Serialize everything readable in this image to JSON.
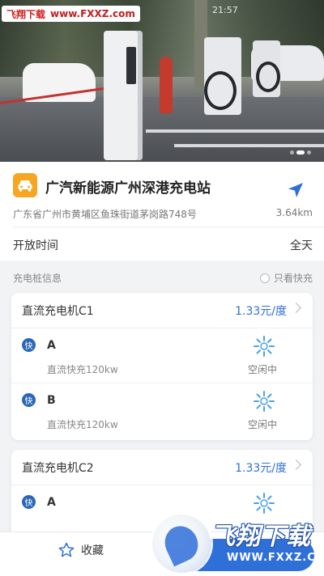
{
  "watermark": {
    "top_cn": "飞翔下载",
    "top_url": "www.FXXZ.com",
    "logo_cn": "飞翔下载",
    "logo_url": "WWW.FXXZ.COM"
  },
  "status_bar": {
    "time": "21:57"
  },
  "hero": {
    "slides_total": 3,
    "active_slide": 2
  },
  "station": {
    "icon": "car-icon",
    "name": "广汽新能源广州深港充电站",
    "address": "广东省广州市黄埔区鱼珠街道茅岗路748号",
    "distance": "3.64km",
    "hours_label": "开放时间",
    "hours_value": "全天"
  },
  "piles_section": {
    "title": "充电桩信息",
    "fast_only_label": "只看快充"
  },
  "piles": [
    {
      "name": "直流充电机C1",
      "price": "1.33元/度",
      "guns": [
        {
          "badge": "快",
          "name": "A",
          "desc": "直流快充120kw",
          "status": "空闲中"
        },
        {
          "badge": "快",
          "name": "B",
          "desc": "直流快充120kw",
          "status": "空闲中"
        }
      ]
    },
    {
      "name": "直流充电机C2",
      "price": "1.33元/度",
      "guns": [
        {
          "badge": "快",
          "name": "A",
          "desc": "",
          "status": ""
        }
      ]
    }
  ],
  "bottom": {
    "favorite_label": "收藏",
    "colors": {
      "accent": "#2f6fd8",
      "station_icon_bg": "#f6a623"
    }
  }
}
